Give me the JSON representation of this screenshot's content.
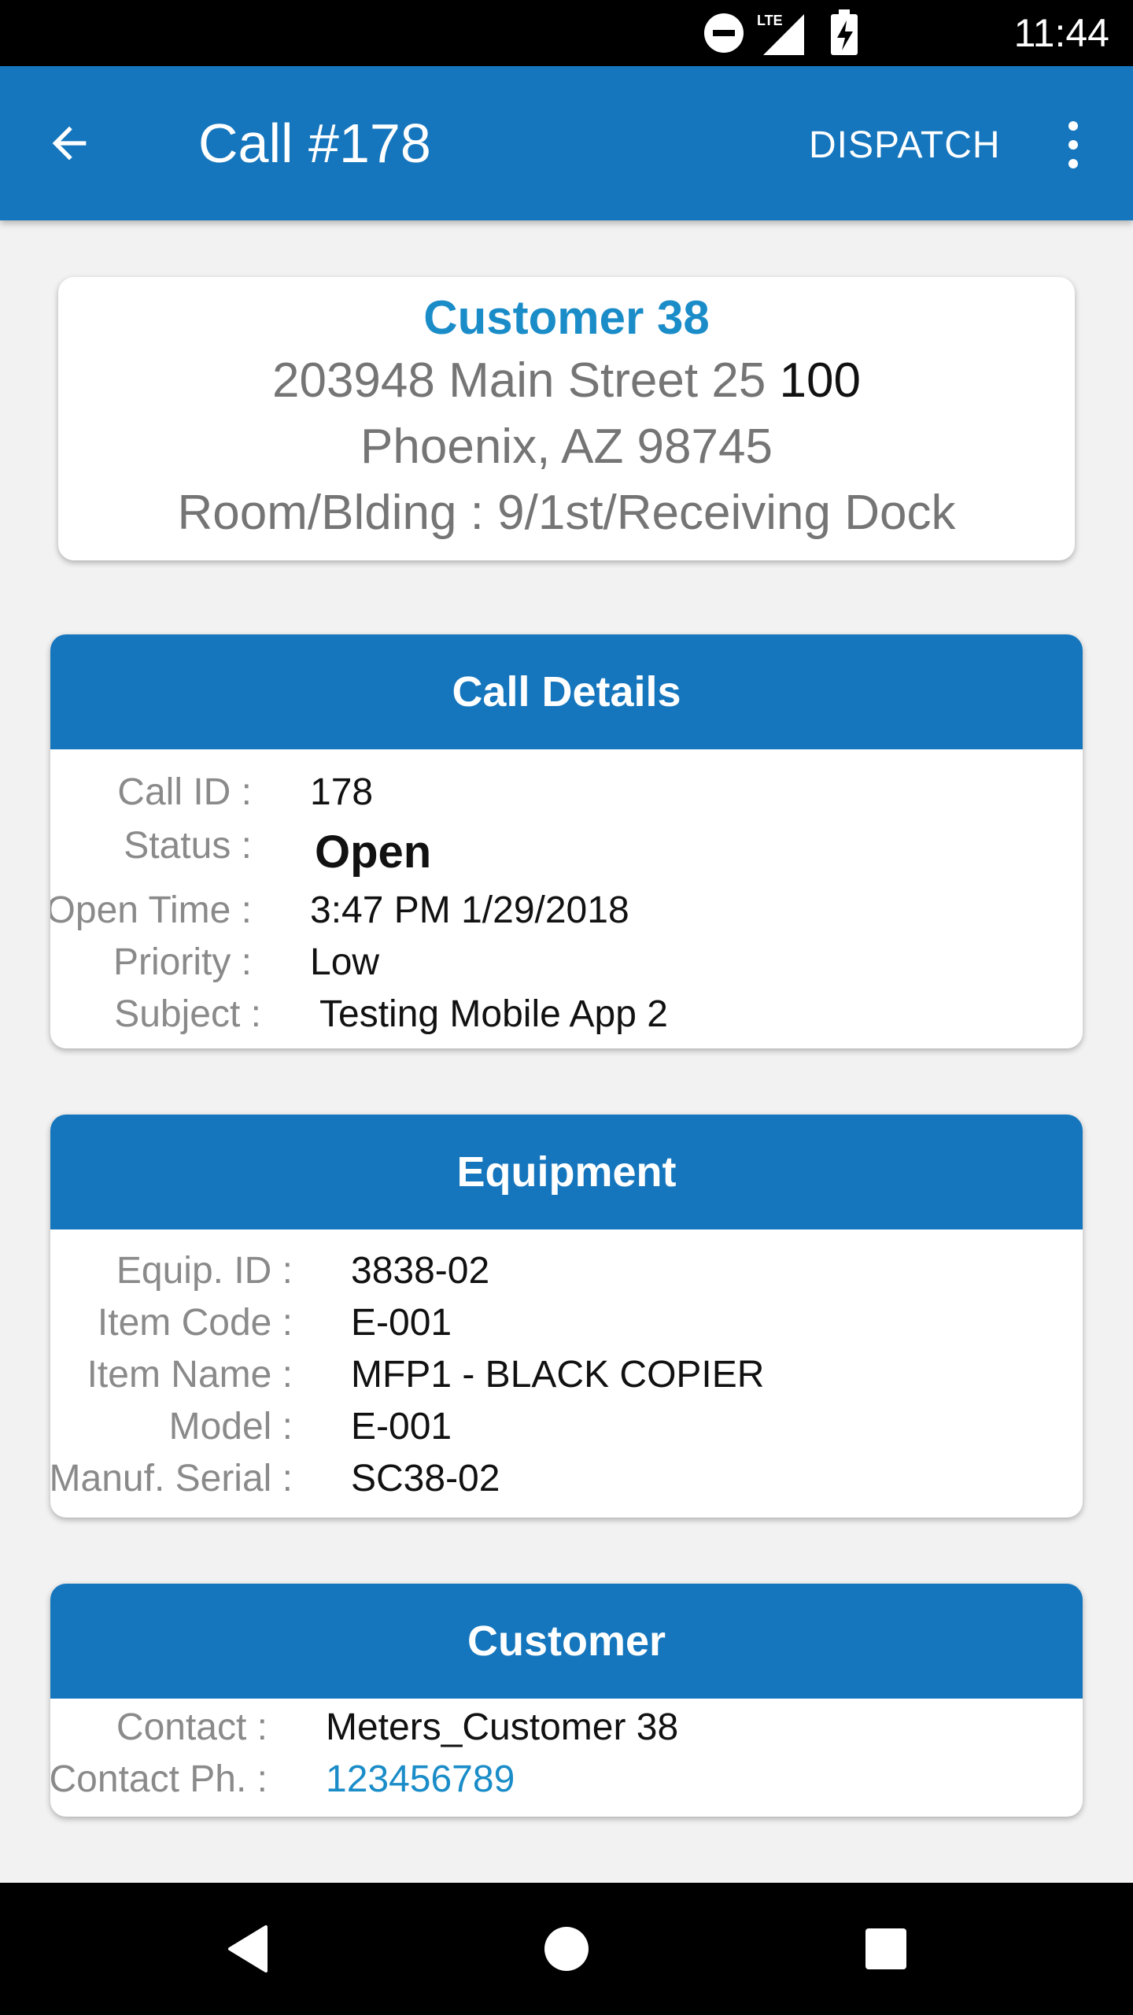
{
  "status_bar": {
    "time": "11:44",
    "network": "LTE",
    "icons": [
      "do-not-disturb-icon",
      "signal-icon",
      "battery-charging-icon"
    ]
  },
  "app_bar": {
    "title": "Call #178",
    "action": "DISPATCH",
    "back_icon": "arrow-back-icon",
    "overflow_icon": "more-vert-icon",
    "color": "#1576bd"
  },
  "address": {
    "customer_name": "Customer 38",
    "street": "203948 Main Street 25 ",
    "street_suffix": "100",
    "city_state_zip": "Phoenix, AZ 98745",
    "room_label": "Room/Blding : ",
    "room_value": " 9/1st/Receiving Dock"
  },
  "call_details": {
    "title": "Call Details",
    "rows": [
      {
        "label": "Call ID :",
        "value": "178"
      },
      {
        "label": "Status :",
        "value": "Open"
      },
      {
        "label": "Open Time :",
        "value": "3:47 PM 1/29/2018"
      },
      {
        "label": "Priority :",
        "value": "Low"
      },
      {
        "label": "Subject :",
        "value": "Testing Mobile App 2"
      }
    ]
  },
  "equipment": {
    "title": "Equipment",
    "rows": [
      {
        "label": "Equip. ID :",
        "value": "3838-02"
      },
      {
        "label": "Item Code :",
        "value": "E-001"
      },
      {
        "label": "Item Name :",
        "value": "MFP1 - BLACK COPIER"
      },
      {
        "label": "Model :",
        "value": "E-001"
      },
      {
        "label": "Manuf. Serial :",
        "value": "SC38-02"
      }
    ]
  },
  "customer": {
    "title": "Customer",
    "rows": [
      {
        "label": "Contact :",
        "value": "Meters_Customer 38"
      },
      {
        "label": "Contact Ph. :",
        "value": "123456789"
      }
    ]
  },
  "nav_bar": {
    "icons": [
      "back-triangle-icon",
      "home-circle-icon",
      "recents-square-icon"
    ]
  },
  "colors": {
    "primary": "#1576bd",
    "accent_text": "#1a8cc8",
    "label_gray": "#8a8a8a"
  }
}
